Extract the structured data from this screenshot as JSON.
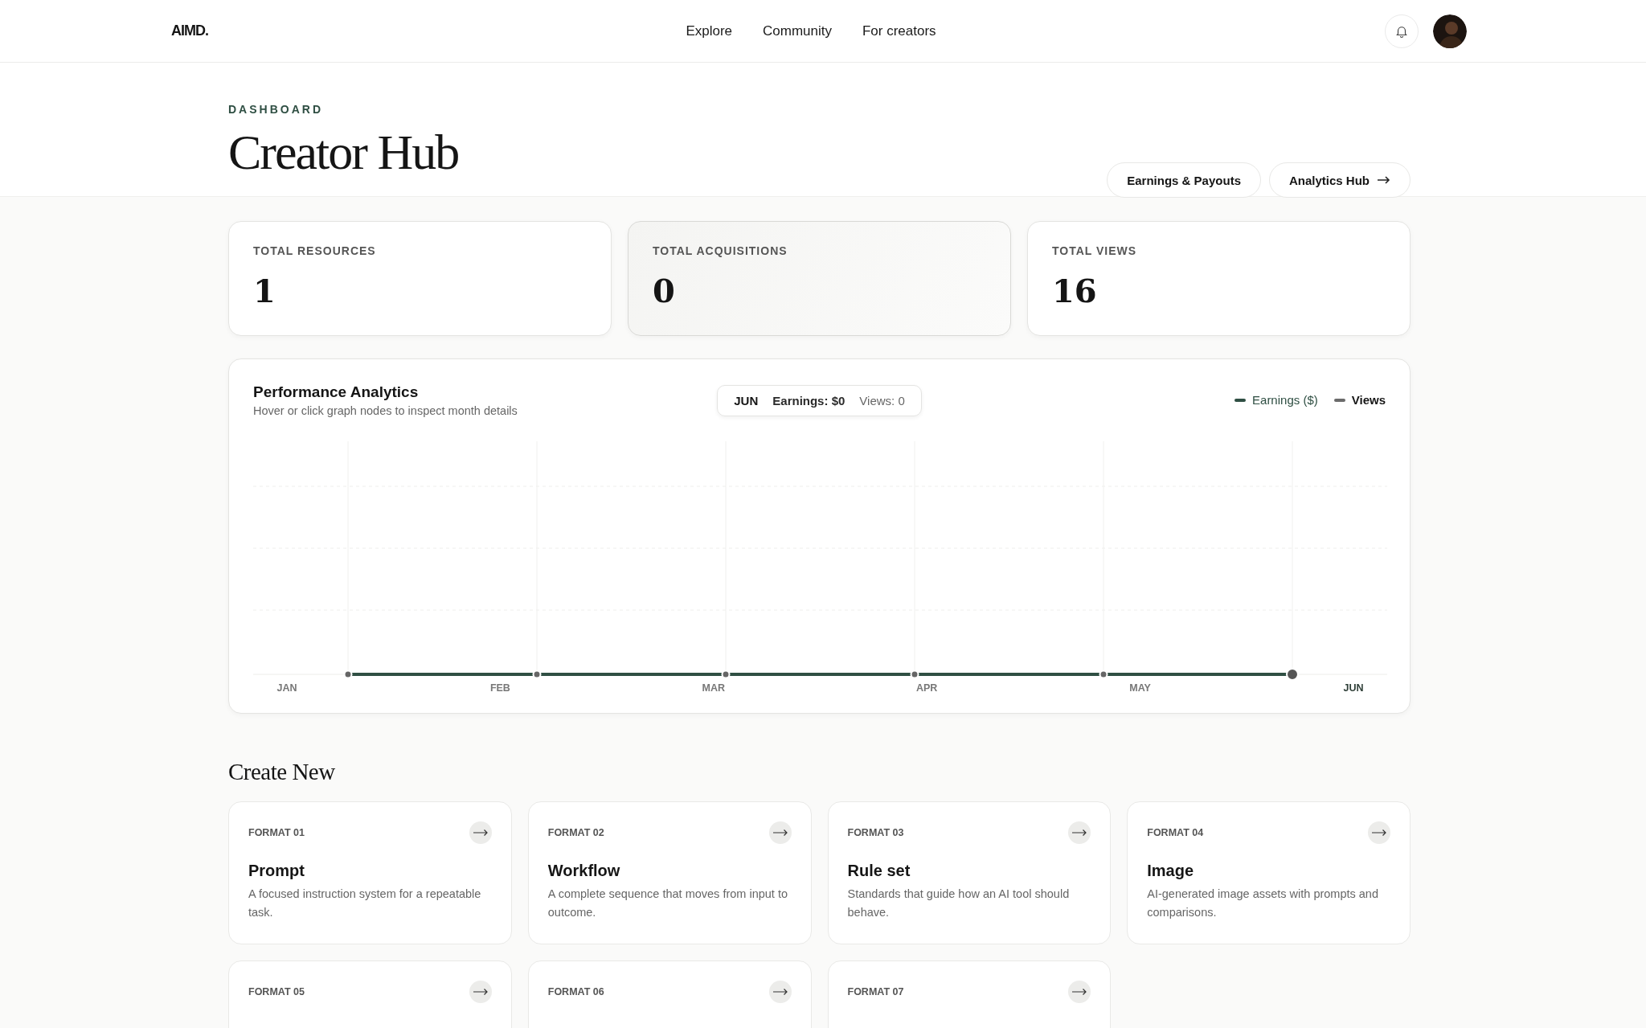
{
  "header": {
    "logo": "AIMD.",
    "nav": [
      {
        "label": "Explore"
      },
      {
        "label": "Community"
      },
      {
        "label": "For creators"
      }
    ]
  },
  "page": {
    "eyebrow": "DASHBOARD",
    "title": "Creator Hub",
    "actions": [
      {
        "label": "Earnings & Payouts",
        "arrow": false
      },
      {
        "label": "Analytics Hub",
        "arrow": true
      }
    ]
  },
  "stats": [
    {
      "label": "TOTAL RESOURCES",
      "value": "1",
      "selected": false
    },
    {
      "label": "TOTAL ACQUISITIONS",
      "value": "0",
      "selected": true
    },
    {
      "label": "TOTAL VIEWS",
      "value": "16",
      "selected": false
    }
  ],
  "analytics": {
    "title": "Performance Analytics",
    "subtitle": "Hover or click graph nodes to inspect month details",
    "tooltip": {
      "month": "JUN",
      "earnings": "Earnings: $0",
      "views": "Views: 0"
    },
    "legend": [
      {
        "label": "Earnings ($)",
        "color": "#2f4f43"
      },
      {
        "label": "Views",
        "color": "#6b6b6b"
      }
    ],
    "months": [
      {
        "label": "JAN",
        "selected": false
      },
      {
        "label": "FEB",
        "selected": false
      },
      {
        "label": "MAR",
        "selected": false
      },
      {
        "label": "APR",
        "selected": false
      },
      {
        "label": "MAY",
        "selected": false
      },
      {
        "label": "JUN",
        "selected": true
      }
    ]
  },
  "create": {
    "title": "Create New",
    "formats": [
      {
        "label": "FORMAT 01",
        "title": "Prompt",
        "description": "A focused instruction system for a repeatable task."
      },
      {
        "label": "FORMAT 02",
        "title": "Workflow",
        "description": "A complete sequence that moves from input to outcome."
      },
      {
        "label": "FORMAT 03",
        "title": "Rule set",
        "description": "Standards that guide how an AI tool should behave."
      },
      {
        "label": "FORMAT 04",
        "title": "Image",
        "description": "AI-generated image assets with prompts and comparisons."
      },
      {
        "label": "FORMAT 05"
      },
      {
        "label": "FORMAT 06"
      },
      {
        "label": "FORMAT 07"
      }
    ]
  }
}
